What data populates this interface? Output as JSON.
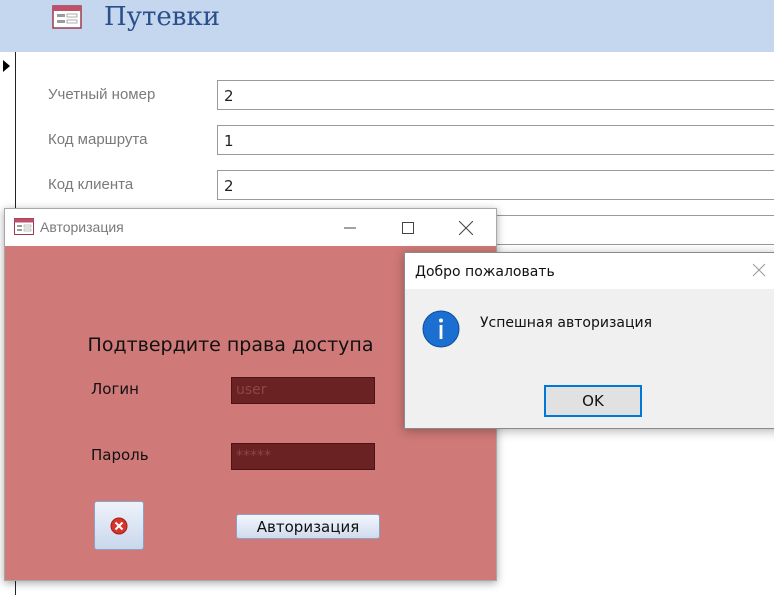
{
  "form": {
    "title": "Путевки",
    "fields": [
      {
        "label": "Учетный номер",
        "value": "2"
      },
      {
        "label": "Код маршрута",
        "value": "1"
      },
      {
        "label": "Код клиента",
        "value": "2"
      }
    ]
  },
  "auth_window": {
    "title": "Авторизация",
    "heading": "Подтвердите права доступа",
    "login_label": "Логин",
    "login_value": "user",
    "password_label": "Пароль",
    "password_value": "*****",
    "submit_label": "Авторизация",
    "background_color": "#cf7978",
    "input_color": "#6b2222"
  },
  "message_box": {
    "title": "Добро пожаловать",
    "message": "Успешная авторизация",
    "ok_label": "OK",
    "accent_color": "#0078d7"
  },
  "colors": {
    "header_bg": "#c5d7ee",
    "title_color": "#2b4f8a"
  }
}
